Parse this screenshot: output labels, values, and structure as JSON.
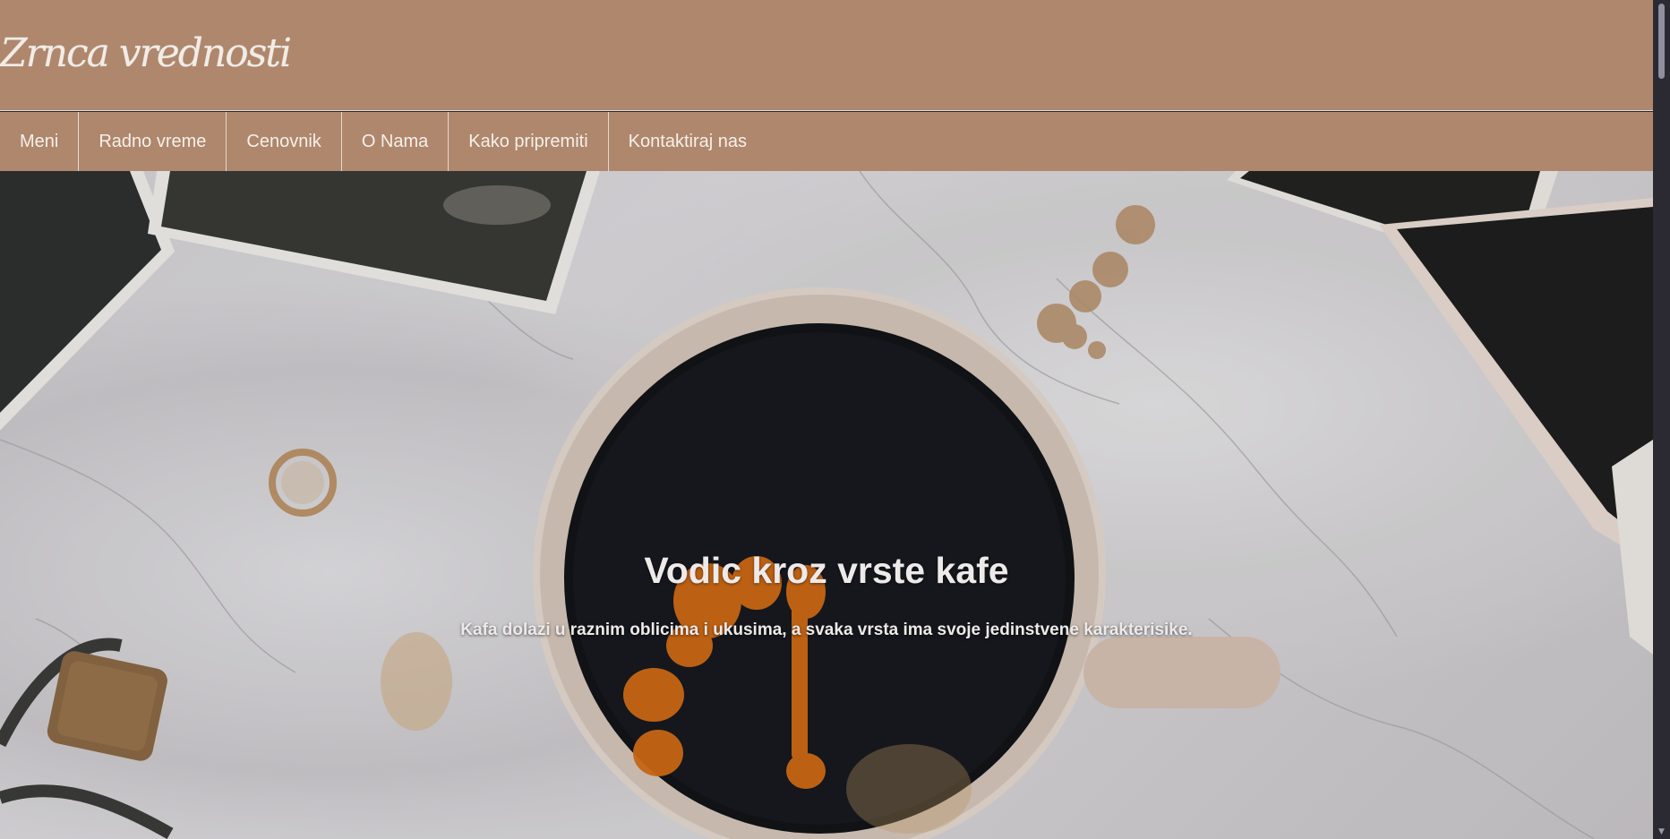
{
  "header": {
    "site_title": "Zrnca vrednosti"
  },
  "nav": {
    "items": [
      {
        "label": "Meni"
      },
      {
        "label": "Radno vreme"
      },
      {
        "label": "Cenovnik"
      },
      {
        "label": "O Nama"
      },
      {
        "label": "Kako pripremiti"
      },
      {
        "label": "Kontaktiraj nas"
      }
    ]
  },
  "hero": {
    "title": "Vodic kroz vrste kafe",
    "subtitle": "Kafa dolazi u raznim oblicima i ukusima, a svaka vrsta ima svoje jedinstvene karakterisike."
  },
  "colors": {
    "header_bg": "#ae876d",
    "nav_text": "#f6f0ea",
    "scrollbar_bg": "#2b2a33"
  },
  "icons": {
    "scroll_down": "chevron-down-icon"
  }
}
